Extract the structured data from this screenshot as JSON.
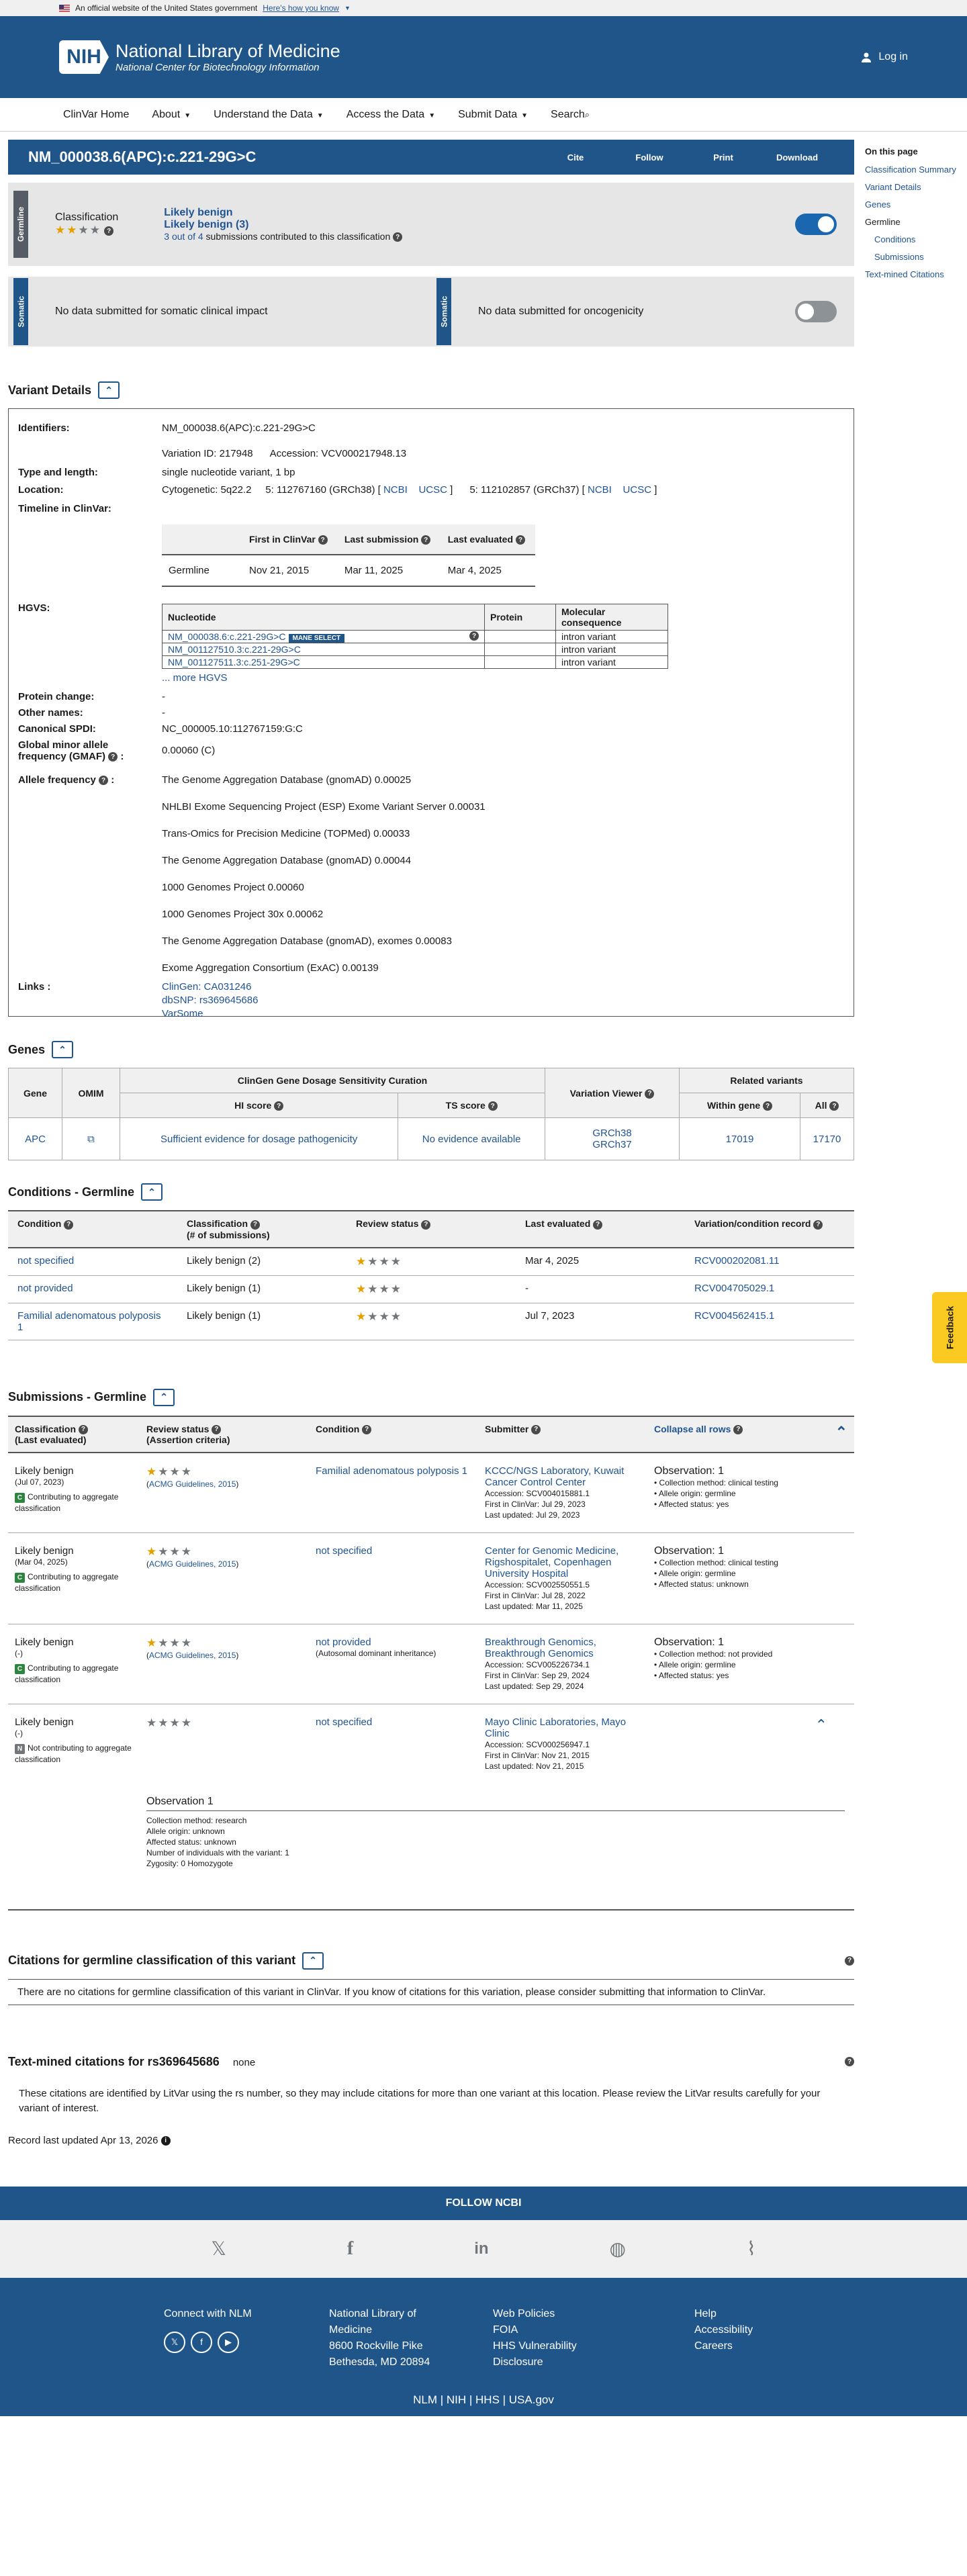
{
  "gov_banner": {
    "text": "An official website of the United States government",
    "link": "Here's how you know"
  },
  "header": {
    "logo": "NIH",
    "title": "National Library of Medicine",
    "subtitle": "National Center for Biotechnology Information",
    "login": "Log in"
  },
  "nav": [
    "ClinVar Home",
    "About",
    "Understand the Data",
    "Access the Data",
    "Submit Data",
    "Search"
  ],
  "sidebar": {
    "heading": "On this page",
    "items": [
      "Classification Summary",
      "Variant Details",
      "Genes",
      "Germline",
      "Conditions",
      "Submissions",
      "Text-mined Citations"
    ]
  },
  "title_bar": {
    "title": "NM_000038.6(APC):c.221-29G>C",
    "actions": [
      "Cite",
      "Follow",
      "Print",
      "Download"
    ]
  },
  "germline": {
    "label": "Germline",
    "classification_label": "Classification",
    "stars": "★★",
    "stars_empty": "★★",
    "class1": "Likely benign",
    "class2": "Likely benign (3)",
    "submissions_count": "3 out of 4",
    "submissions_text": "submissions contributed to this classification"
  },
  "somatic": {
    "label1": "Somatic",
    "text1": "No data submitted for somatic clinical impact",
    "label2": "Somatic",
    "text2": "No data submitted for oncogenicity"
  },
  "variant_details": {
    "heading": "Variant Details",
    "identifiers_k": "Identifiers:",
    "identifiers_v": "NM_000038.6(APC):c.221-29G>C",
    "variation_id": "Variation ID: 217948",
    "accession": "Accession: VCV000217948.13",
    "type_k": "Type and length:",
    "type_v": "single nucleotide variant, 1 bp",
    "location_k": "Location:",
    "cyto": "Cytogenetic: 5q22.2",
    "loc38": "5: 112767160 (GRCh38) [",
    "loc37": "5: 112102857 (GRCh37) [",
    "ncbi": "NCBI",
    "ucsc": "UCSC",
    "bracket_close": "]",
    "timeline_k": "Timeline in ClinVar:",
    "timeline_headers": [
      "First in ClinVar",
      "Last submission",
      "Last evaluated"
    ],
    "timeline_row": [
      "Germline",
      "Nov 21, 2015",
      "Mar 11, 2025",
      "Mar 4, 2025"
    ],
    "hgvs_k": "HGVS:",
    "hgvs_headers": [
      "Nucleotide",
      "Protein",
      "Molecular consequence"
    ],
    "hgvs_rows": [
      [
        "NM_000038.6:c.221-29G>C",
        "",
        "intron variant"
      ],
      [
        "NM_001127510.3:c.221-29G>C",
        "",
        "intron variant"
      ],
      [
        "NM_001127511.3:c.251-29G>C",
        "",
        "intron variant"
      ]
    ],
    "mane": "MANE SELECT",
    "more_hgvs": "... more HGVS",
    "protein_change_k": "Protein change:",
    "protein_change_v": "-",
    "other_names_k": "Other names:",
    "other_names_v": "-",
    "spdi_k": "Canonical SPDI:",
    "spdi_v": "NC_000005.10:112767159:G:C",
    "gmaf_k1": "Global minor allele",
    "gmaf_k2": "frequency (GMAF)",
    "gmaf_v": "0.00060 (C)",
    "af_k": "Allele frequency",
    "allele_freqs": [
      "The Genome Aggregation Database (gnomAD) 0.00025",
      "NHLBI Exome Sequencing Project (ESP) Exome Variant Server 0.00031",
      "Trans-Omics for Precision Medicine (TOPMed) 0.00033",
      "The Genome Aggregation Database (gnomAD) 0.00044",
      "1000 Genomes Project 0.00060",
      "1000 Genomes Project 30x 0.00062",
      "The Genome Aggregation Database (gnomAD), exomes 0.00083",
      "Exome Aggregation Consortium (ExAC) 0.00139"
    ],
    "links_k": "Links :",
    "links": [
      "ClinGen: CA031246",
      "dbSNP: rs369645686",
      "VarSome"
    ]
  },
  "genes": {
    "heading": "Genes",
    "headers": {
      "gene": "Gene",
      "omim": "OMIM",
      "clingen": "ClinGen Gene Dosage Sensitivity Curation",
      "hi": "HI score",
      "ts": "TS score",
      "viewer": "Variation Viewer",
      "related": "Related variants",
      "within": "Within gene",
      "all": "All"
    },
    "row": {
      "gene": "APC",
      "hi": "Sufficient evidence for dosage pathogenicity",
      "ts": "No evidence available",
      "grch38": "GRCh38",
      "grch37": "GRCh37",
      "within": "17019",
      "all": "17170"
    }
  },
  "conditions": {
    "heading": "Conditions - Germline",
    "headers": [
      "Condition",
      "Classification",
      "(# of submissions)",
      "Review status",
      "Last evaluated",
      "Variation/condition record"
    ],
    "rows": [
      {
        "condition": "not specified",
        "classification": "Likely benign (2)",
        "last": "Mar 4, 2025",
        "record": "RCV000202081.11"
      },
      {
        "condition": "not provided",
        "classification": "Likely benign (1)",
        "last": "-",
        "record": "RCV004705029.1"
      },
      {
        "condition": "Familial adenomatous polyposis 1",
        "classification": "Likely benign (1)",
        "last": "Jul 7, 2023",
        "record": "RCV004562415.1"
      }
    ]
  },
  "submissions": {
    "heading": "Submissions - Germline",
    "headers": {
      "classification": "Classification",
      "class_sub": "(Last evaluated)",
      "review": "Review status",
      "review_sub": "(Assertion criteria)",
      "condition": "Condition",
      "submitter": "Submitter",
      "collapse": "Collapse all rows"
    },
    "contrib": "Contributing to aggregate classification",
    "noncontrib": "Not contributing to aggregate classification",
    "acmg": "ACMG Guidelines, 2015",
    "rows": [
      {
        "cls": "Likely benign",
        "date": "(Jul 07, 2023)",
        "cond": "Familial adenomatous polyposis 1",
        "cond_sub": "",
        "sub": "KCCC/NGS Laboratory, Kuwait Cancer Control Center",
        "acc": "Accession: SCV004015881.1",
        "first": "First in ClinVar: Jul 29, 2023",
        "updated": "Last updated: Jul 29, 2023",
        "obs": "Observation: 1",
        "method": "Collection method: clinical testing",
        "origin": "Allele origin: germline",
        "status": "Affected status: yes"
      },
      {
        "cls": "Likely benign",
        "date": "(Mar 04, 2025)",
        "cond": "not specified",
        "cond_sub": "",
        "sub": "Center for Genomic Medicine, Rigshospitalet, Copenhagen University Hospital",
        "acc": "Accession: SCV002550551.5",
        "first": "First in ClinVar: Jul 28, 2022",
        "updated": "Last updated: Mar 11, 2025",
        "obs": "Observation: 1",
        "method": "Collection method: clinical testing",
        "origin": "Allele origin: germline",
        "status": "Affected status: unknown"
      },
      {
        "cls": "Likely benign",
        "date": "(-)",
        "cond": "not provided",
        "cond_sub": "(Autosomal dominant inheritance)",
        "sub": "Breakthrough Genomics, Breakthrough Genomics",
        "acc": "Accession: SCV005226734.1",
        "first": "First in ClinVar: Sep 29, 2024",
        "updated": "Last updated: Sep 29, 2024",
        "obs": "Observation: 1",
        "method": "Collection method: not provided",
        "origin": "Allele origin: germline",
        "status": "Affected status: yes"
      }
    ],
    "row4": {
      "cls": "Likely benign",
      "date": "(-)",
      "cond": "not specified",
      "sub": "Mayo Clinic Laboratories, Mayo Clinic",
      "acc": "Accession: SCV000256947.1",
      "first": "First in ClinVar: Nov 21, 2015",
      "updated": "Last updated: Nov 21, 2015"
    },
    "obs_detail": {
      "title": "Observation 1",
      "lines": [
        "Collection method: research",
        "Allele origin: unknown",
        "Affected status: unknown",
        "Number of individuals with the variant: 1",
        "Zygosity: 0 Homozygote"
      ]
    }
  },
  "citations": {
    "heading": "Citations for germline classification of this variant",
    "text": "There are no citations for germline classification of this variant in ClinVar. If you know of citations for this variation, please consider submitting that information to ClinVar."
  },
  "textmined": {
    "heading": "Text-mined citations for rs369645686",
    "none": "none",
    "text": "These citations are identified by LitVar using the rs number, so they may include citations for more than one variant at this location. Please review the LitVar results carefully for your variant of interest."
  },
  "record_updated": "Record last updated Apr 13, 2026",
  "feedback": "Feedback",
  "footer": {
    "follow": "FOLLOW NCBI",
    "connect": "Connect with NLM",
    "address": [
      "National Library of",
      "Medicine",
      "8600 Rockville Pike",
      "Bethesda, MD 20894"
    ],
    "col3": [
      "Web Policies",
      "FOIA",
      "HHS Vulnerability",
      "Disclosure"
    ],
    "col4": [
      "Help",
      "Accessibility",
      "Careers"
    ],
    "bottom": "NLM | NIH | HHS | USA.gov"
  }
}
